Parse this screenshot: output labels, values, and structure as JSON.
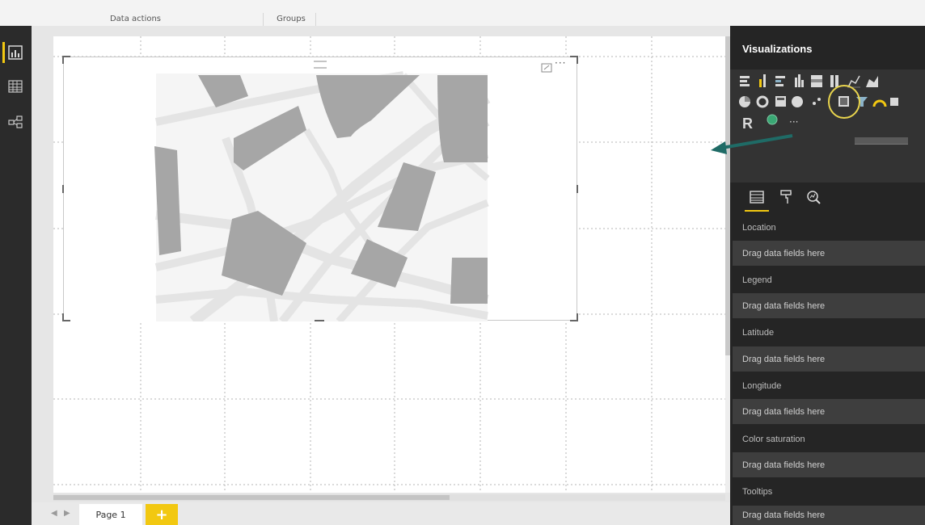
{
  "ribbon": {
    "groups": [
      {
        "label": "Data actions"
      },
      {
        "label": "Groups"
      }
    ]
  },
  "left_nav": {
    "items": [
      {
        "name": "report-view",
        "icon": "bar-chart-icon",
        "active": true
      },
      {
        "name": "data-view",
        "icon": "table-grid-icon",
        "active": false
      },
      {
        "name": "relationships-view",
        "icon": "relationships-icon",
        "active": false
      }
    ]
  },
  "visual": {
    "more_label": "···"
  },
  "pages": {
    "tabs": [
      {
        "label": "Page 1"
      }
    ],
    "add_label": "+"
  },
  "visualizations": {
    "title": "Visualizations",
    "more_label": "···",
    "r_label": "R",
    "highlighted_icon": "filled-map-icon",
    "accent_color": "#f2c811",
    "arrow_color": "#1f6b66",
    "pane_tabs": [
      {
        "name": "fields",
        "icon": "fields-icon"
      },
      {
        "name": "format",
        "icon": "paint-roller-icon"
      },
      {
        "name": "analytics",
        "icon": "analytics-magnifier-icon"
      }
    ],
    "wells": [
      {
        "label": "Location",
        "placeholder": "Drag data fields here"
      },
      {
        "label": "Legend",
        "placeholder": "Drag data fields here"
      },
      {
        "label": "Latitude",
        "placeholder": "Drag data fields here"
      },
      {
        "label": "Longitude",
        "placeholder": "Drag data fields here"
      },
      {
        "label": "Color saturation",
        "placeholder": "Drag data fields here"
      },
      {
        "label": "Tooltips",
        "placeholder": "Drag data fields here"
      }
    ]
  }
}
